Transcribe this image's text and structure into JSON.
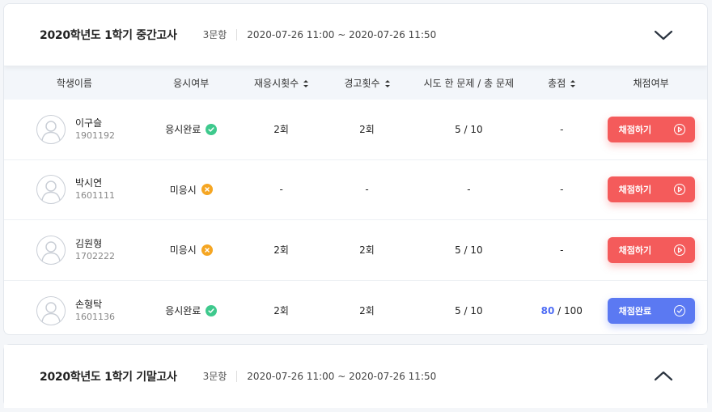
{
  "exams": [
    {
      "title": "2020학년도 1학기 중간고사",
      "question_count": "3문항",
      "date_range": "2020-07-26 11:00 ~ 2020-07-26 11:50",
      "expanded": true
    },
    {
      "title": "2020학년도 1학기 기말고사",
      "question_count": "3문항",
      "date_range": "2020-07-26 11:00 ~ 2020-07-26 11:50",
      "expanded": false
    }
  ],
  "table": {
    "headers": {
      "name": "학생이름",
      "status": "응시여부",
      "retakes": "재응시횟수",
      "warnings": "경고횟수",
      "attempted": "시도 한 문제 / 총 문제",
      "total": "총점",
      "grading": "채점여부"
    },
    "rows": [
      {
        "name": "이구슬",
        "id": "1901192",
        "status": "응시완료",
        "status_type": "done",
        "retakes": "2회",
        "warnings": "2회",
        "attempted": "5 / 10",
        "score": "-",
        "score_max": "",
        "button": "채점하기",
        "button_type": "grade"
      },
      {
        "name": "박시연",
        "id": "1601111",
        "status": "미응시",
        "status_type": "absent",
        "retakes": "-",
        "warnings": "-",
        "attempted": "-",
        "score": "-",
        "score_max": "",
        "button": "채점하기",
        "button_type": "grade"
      },
      {
        "name": "김원형",
        "id": "1702222",
        "status": "미응시",
        "status_type": "absent",
        "retakes": "2회",
        "warnings": "2회",
        "attempted": "5 / 10",
        "score": "-",
        "score_max": "",
        "button": "채점하기",
        "button_type": "grade"
      },
      {
        "name": "손형탁",
        "id": "1601136",
        "status": "응시완료",
        "status_type": "done",
        "retakes": "2회",
        "warnings": "2회",
        "attempted": "5 / 10",
        "score": "80",
        "score_max": " / 100",
        "button": "채점완료",
        "button_type": "done"
      }
    ]
  },
  "colors": {
    "grade_button": "#f45b5b",
    "done_button": "#5b79f2",
    "status_done": "#3ec98d",
    "status_absent": "#f5a623",
    "score_highlight": "#4f6df5"
  },
  "icons": {
    "expanded_toggle": "chevron-down-icon",
    "collapsed_toggle": "chevron-up-icon",
    "avatar": "user-placeholder-icon",
    "status_done": "check-circle-icon",
    "status_absent": "x-circle-icon",
    "grade_button": "play-circle-icon",
    "done_button": "check-circle-outline-icon"
  }
}
